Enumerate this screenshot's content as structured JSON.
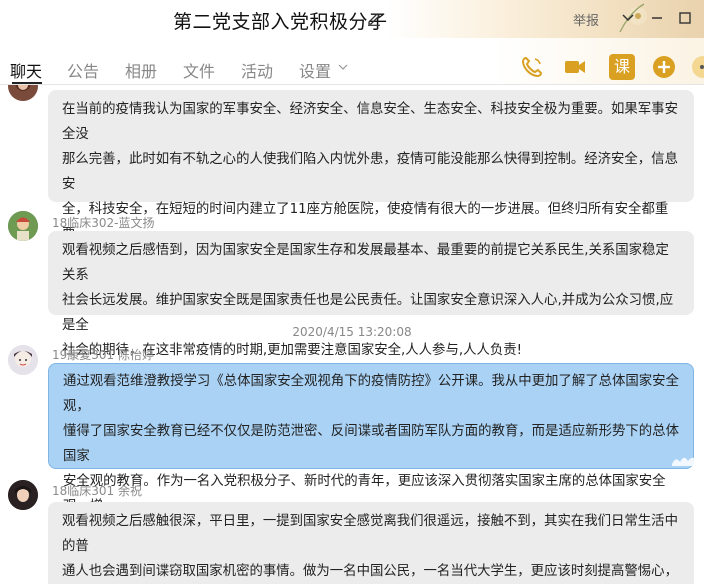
{
  "window": {
    "title": "第二党支部入党积极分子",
    "report_label": "举报"
  },
  "tabs": [
    {
      "label": "聊天"
    },
    {
      "label": "公告"
    },
    {
      "label": "相册"
    },
    {
      "label": "文件"
    },
    {
      "label": "活动"
    },
    {
      "label": "设置"
    }
  ],
  "toolbar": {
    "lesson_label": "课"
  },
  "messages": [
    {
      "sender": "",
      "text": "在当前的疫情我认为国家的军事安全、经济安全、信息安全、生态安全、科技安全极为重要。如果军事安全没\n那么完善，此时如有不轨之心的人使我们陷入内忧外患，疫情可能没能那么快得到控制。经济安全，信息安\n全，科技安全，在短短的时间内建立了11座方舱医院，使疫情有很大的一步进展。但终归所有安全都重要，\n需要层层结合。"
    },
    {
      "sender": "18临床302-蓝文扬",
      "text": "观看视频之后感悟到，因为国家安全是国家生存和发展最基本、最重要的前提它关系民生,关系国家稳定关系\n社会长远发展。维护国家安全既是国家责任也是公民责任。让国家安全意识深入人心,并成为公众习惯,应是全\n社会的期待，在这非常疫情的时期,更加需要注意国家安全,人人参与,人人负责!"
    },
    {
      "timestamp": "2020/4/15 13:20:08"
    },
    {
      "sender": "19康复301   陈怡婷",
      "text": "通过观看范维澄教授学习《总体国家安全观视角下的疫情防控》公开课。我从中更加了解了总体国家安全观，\n懂得了国家安全教育已经不仅仅是防范泄密、反间谍或者国防军队方面的教育，而是适应新形势下的总体国家\n安全观的教育。作为一名入党积极分子、新时代的青年，更应该深入贯彻落实国家主席的总体国家安全观，增\n强自觉投身国家安全责任感和使命感，尊法学法守法用法，履行维护国家安全的义务。"
    },
    {
      "sender": "18临床301 余祝",
      "text": "观看视频之后感触很深，平日里，一提到国家安全感觉离我们很遥远，接触不到，其实在我们日常生活中的普\n通人也会遇到间谍窃取国家机密的事情。做为一名中国公民，一名当代大学生，更应该时刻提高警惕心，坚决\n保守国家机密保卫国家安全。"
    }
  ],
  "colors": {
    "bubble_gray": "#ececec",
    "bubble_blue": "#a9d2f5",
    "accent_orange": "#d9a021"
  }
}
